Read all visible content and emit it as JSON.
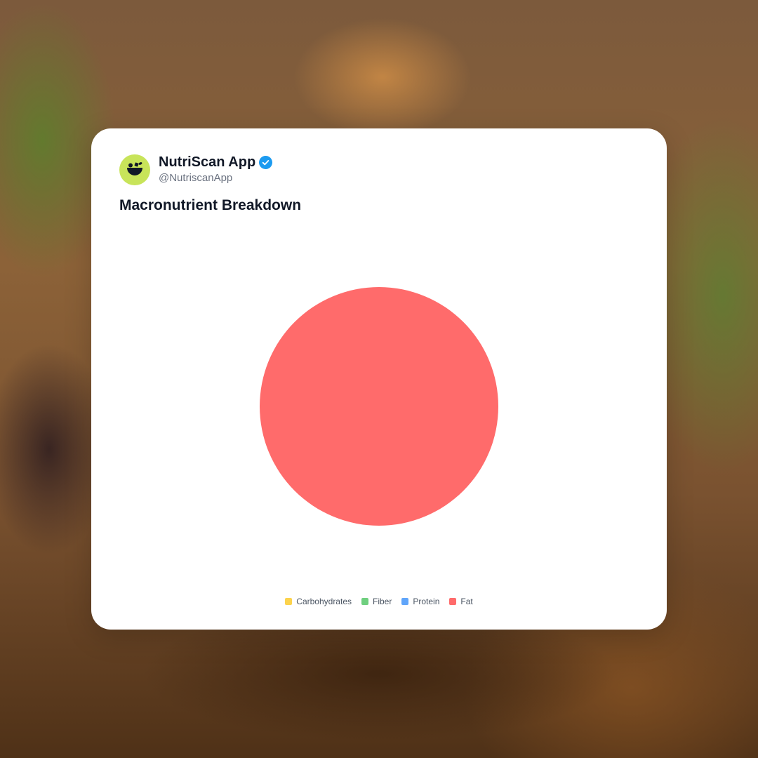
{
  "post": {
    "display_name": "NutriScan App",
    "handle": "@NutriscanApp",
    "verified": true,
    "avatar_color": "#c8e45a"
  },
  "colors": {
    "verified_badge": "#1d9bf0",
    "card_background": "#ffffff"
  },
  "chart_data": {
    "type": "pie",
    "title": "Macronutrient Breakdown",
    "categories": [
      "Carbohydrates",
      "Fiber",
      "Protein",
      "Fat"
    ],
    "values": [
      0,
      0,
      0,
      100
    ],
    "colors": [
      "#fcd34d",
      "#6fcf7f",
      "#60a5fa",
      "#ff6b6b"
    ],
    "legend_position": "bottom"
  }
}
